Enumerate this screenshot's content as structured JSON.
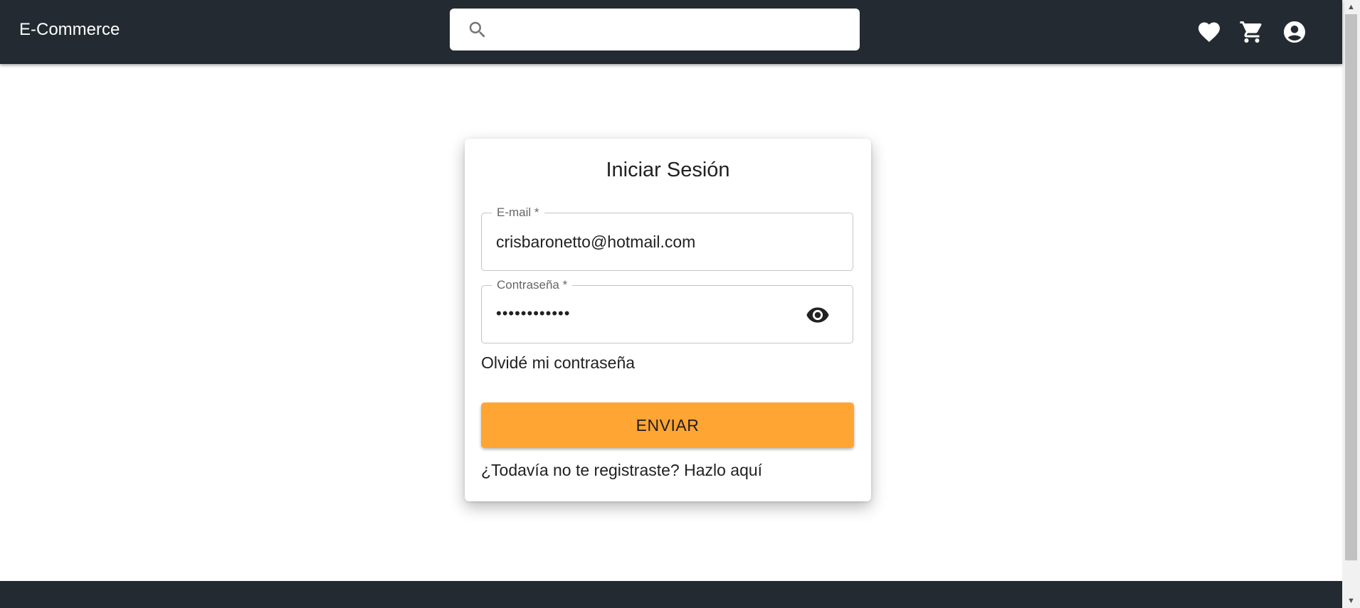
{
  "header": {
    "brand": "E-Commerce",
    "search_placeholder": "",
    "icons": [
      "favorite-icon",
      "cart-icon",
      "account-icon"
    ]
  },
  "login": {
    "title": "Iniciar Sesión",
    "email_label": "E-mail *",
    "email_value": "crisbaronetto@hotmail.com",
    "password_label": "Contraseña *",
    "password_value": "••••••••••••",
    "forgot_link": "Olvidé mi contraseña",
    "submit_label": "ENVIAR",
    "register_link": "¿Todavía no te registraste? Hazlo aquí"
  },
  "colors": {
    "appbar": "#242a31",
    "accent": "#ffa534",
    "background": "#ffffff"
  }
}
